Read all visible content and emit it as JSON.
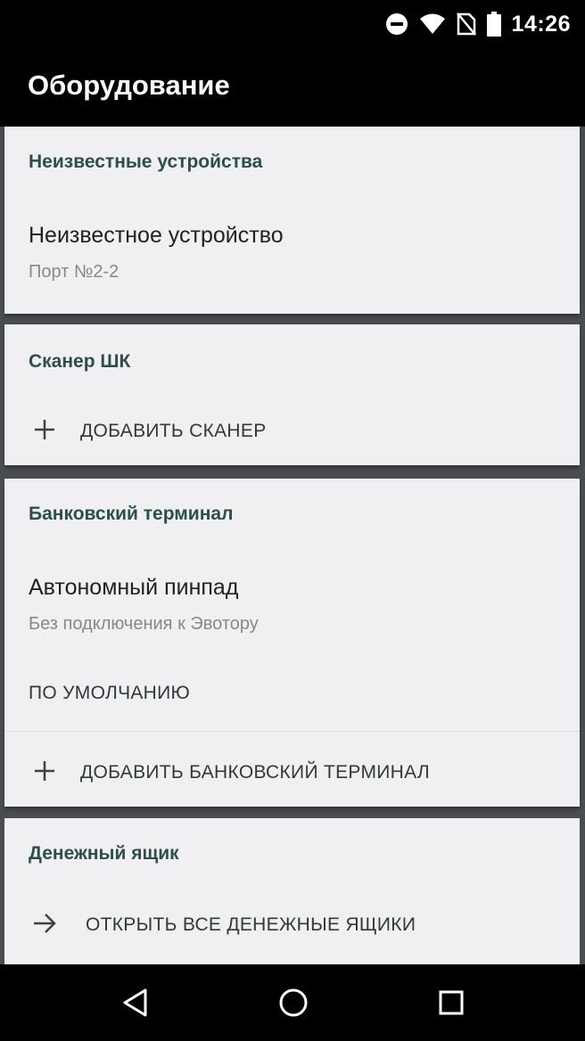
{
  "status_bar": {
    "time": "14:26",
    "icons": [
      "do-not-disturb-icon",
      "wifi-icon",
      "no-sim-icon",
      "battery-icon"
    ]
  },
  "app_bar": {
    "title": "Оборудование"
  },
  "sections": {
    "unknown": {
      "header": "Неизвестные устройства",
      "device_name": "Неизвестное устройство",
      "device_port": "Порт №2-2"
    },
    "scanner": {
      "header": "Сканер ШК",
      "add_label": "ДОБАВИТЬ СКАНЕР"
    },
    "bank_terminal": {
      "header": "Банковский терминал",
      "device_name": "Автономный пинпад",
      "device_status": "Без подключения к Эвотору",
      "default_label": "ПО УМОЛЧАНИЮ",
      "add_label": "ДОБАВИТЬ БАНКОВСКИЙ ТЕРМИНАЛ"
    },
    "cash_drawer": {
      "header": "Денежный ящик",
      "open_label": "ОТКРЫТЬ ВСЕ ДЕНЕЖНЫЕ ЯЩИКИ"
    }
  },
  "nav_bar": {
    "icons": [
      "back-icon",
      "home-icon",
      "recents-icon"
    ]
  },
  "colors": {
    "header_text": "#2d4f4a",
    "card_bg": "#f0eff1",
    "content_bg": "#4a4d4f"
  }
}
